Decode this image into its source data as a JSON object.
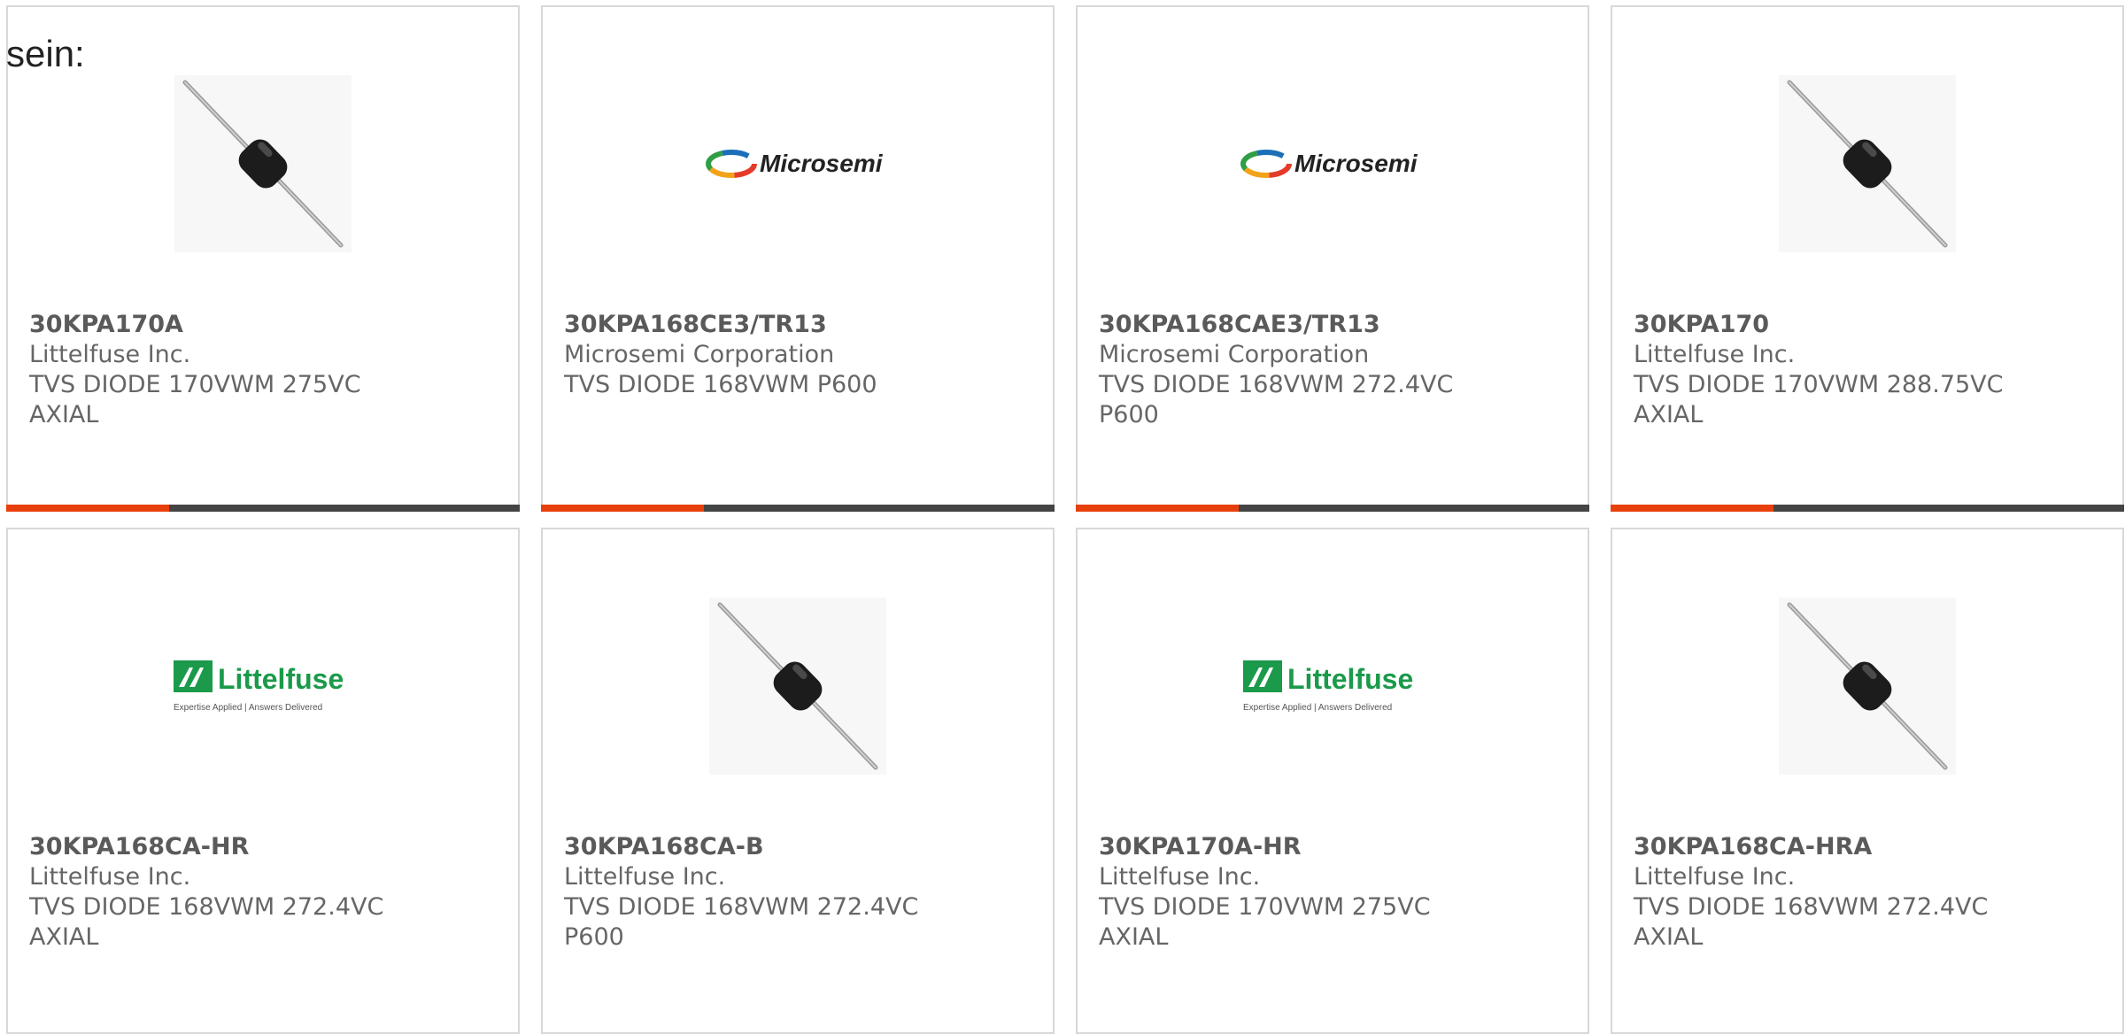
{
  "intro": {
    "text": "sein:"
  },
  "brand": {
    "accent_color": "#e8400c",
    "bar_color": "#444444"
  },
  "products": [
    {
      "part_number": "30KPA170A",
      "manufacturer": "Littelfuse Inc.",
      "desc_line1": "TVS DIODE 170VWM 275VC",
      "desc_line2": "AXIAL",
      "image": "diode"
    },
    {
      "part_number": "30KPA168CE3/TR13",
      "manufacturer": "Microsemi Corporation",
      "desc_line1": "TVS DIODE 168VWM P600",
      "desc_line2": "",
      "image": "microsemi-logo",
      "logo_text": "Microsemi"
    },
    {
      "part_number": "30KPA168CAE3/TR13",
      "manufacturer": "Microsemi Corporation",
      "desc_line1": "TVS DIODE 168VWM 272.4VC",
      "desc_line2": "P600",
      "image": "microsemi-logo",
      "logo_text": "Microsemi"
    },
    {
      "part_number": "30KPA170",
      "manufacturer": "Littelfuse Inc.",
      "desc_line1": "TVS DIODE 170VWM 288.75VC",
      "desc_line2": "AXIAL",
      "image": "diode"
    },
    {
      "part_number": "30KPA168CA-HR",
      "manufacturer": "Littelfuse Inc.",
      "desc_line1": "TVS DIODE 168VWM 272.4VC",
      "desc_line2": "AXIAL",
      "image": "littelfuse-logo",
      "logo_text": "Littelfuse",
      "logo_tagline": "Expertise Applied | Answers Delivered"
    },
    {
      "part_number": "30KPA168CA-B",
      "manufacturer": "Littelfuse Inc.",
      "desc_line1": "TVS DIODE 168VWM 272.4VC",
      "desc_line2": "P600",
      "image": "diode"
    },
    {
      "part_number": "30KPA170A-HR",
      "manufacturer": "Littelfuse Inc.",
      "desc_line1": "TVS DIODE 170VWM 275VC",
      "desc_line2": "AXIAL",
      "image": "littelfuse-logo",
      "logo_text": "Littelfuse",
      "logo_tagline": "Expertise Applied | Answers Delivered"
    },
    {
      "part_number": "30KPA168CA-HRA",
      "manufacturer": "Littelfuse Inc.",
      "desc_line1": "TVS DIODE 168VWM 272.4VC",
      "desc_line2": "AXIAL",
      "image": "diode"
    }
  ]
}
